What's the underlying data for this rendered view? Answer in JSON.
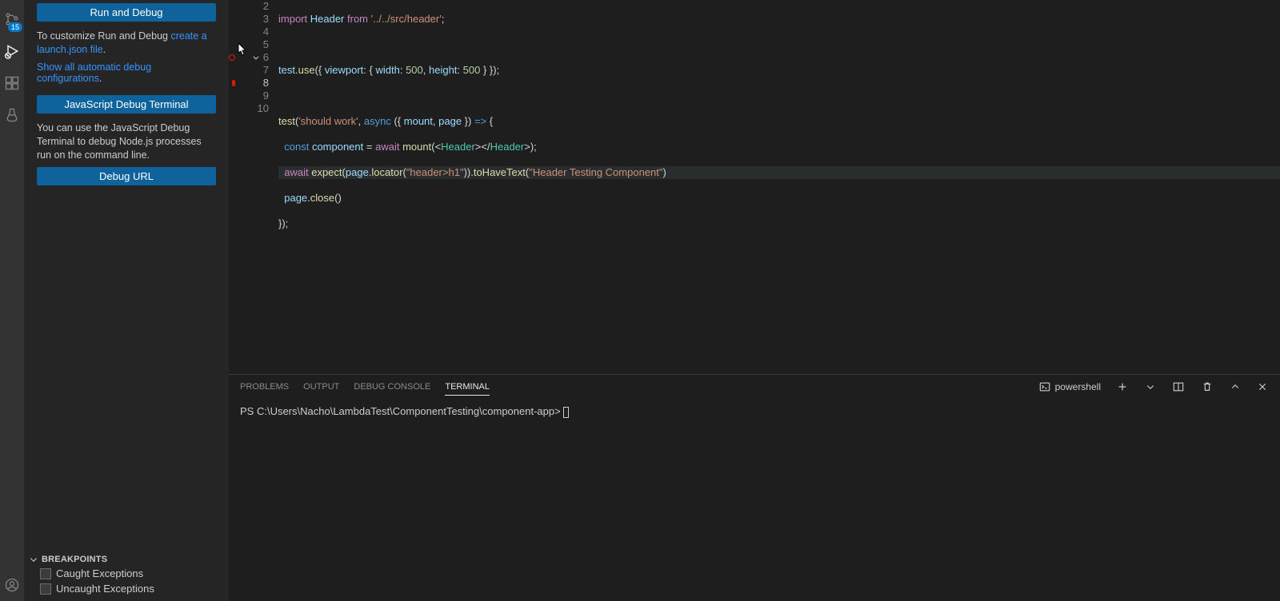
{
  "activity": {
    "badge_count": "15"
  },
  "sidebar": {
    "run_debug_label": "Run and Debug",
    "customize_prefix": "To customize Run and Debug ",
    "customize_link": "create a launch.json file",
    "customize_suffix": ".",
    "show_all": "Show all automatic debug configurations",
    "show_all_suffix": ".",
    "js_terminal_label": "JavaScript Debug Terminal",
    "js_terminal_desc": "You can use the JavaScript Debug Terminal to debug Node.js processes run on the command line.",
    "debug_url_label": "Debug URL",
    "breakpoints_header": "BREAKPOINTS",
    "caught_label": "Caught Exceptions",
    "uncaught_label": "Uncaught Exceptions"
  },
  "editor": {
    "lines": [
      "2",
      "3",
      "4",
      "5",
      "6",
      "7",
      "8",
      "9",
      "10"
    ],
    "current_line": "8"
  },
  "code": {
    "l2_import": "import",
    "l2_header": "Header",
    "l2_from": "from",
    "l2_path": "'../../src/header'",
    "l4_test": "test",
    "l4_use": "use",
    "l4_viewport": "viewport",
    "l4_width": "width",
    "l4_height": "height",
    "l4_500a": "500",
    "l4_500b": "500",
    "l6_test": "test",
    "l6_name": "'should work'",
    "l6_async": "async",
    "l6_mount": "mount",
    "l6_page": "page",
    "l7_const": "const",
    "l7_component": "component",
    "l7_await": "await",
    "l7_mountfn": "mount",
    "l7_tag": "Header",
    "l8_await": "await",
    "l8_expect": "expect",
    "l8_page": "page",
    "l8_locator": "locator",
    "l8_sel": "\"header>h1\"",
    "l8_tohave": "toHaveText",
    "l8_text": "\"Header Testing Component\"",
    "l9_page": "page",
    "l9_close": "close"
  },
  "panel": {
    "tabs": {
      "problems": "PROBLEMS",
      "output": "OUTPUT",
      "debug_console": "DEBUG CONSOLE",
      "terminal": "TERMINAL"
    },
    "term_kind": "powershell",
    "prompt": "PS C:\\Users\\Nacho\\LambdaTest\\ComponentTesting\\component-app> "
  }
}
